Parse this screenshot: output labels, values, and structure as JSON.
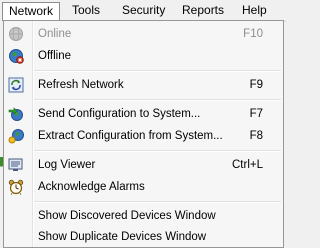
{
  "menubar": {
    "items": [
      "Network",
      "Tools",
      "Security",
      "Reports",
      "Help"
    ]
  },
  "menu": {
    "online": {
      "label": "Online",
      "shortcut": "F10",
      "icon": "online-globe-icon",
      "enabled": false
    },
    "offline": {
      "label": "Offline",
      "icon": "offline-globe-icon"
    },
    "refresh": {
      "label": "Refresh Network",
      "shortcut": "F9",
      "icon": "refresh-icon"
    },
    "send": {
      "label": "Send Configuration to System...",
      "shortcut": "F7",
      "icon": "send-configuration-icon"
    },
    "extract": {
      "label": "Extract Configuration from System...",
      "shortcut": "F8",
      "icon": "extract-configuration-icon"
    },
    "log": {
      "label": "Log Viewer",
      "shortcut": "Ctrl+L",
      "icon": "log-viewer-icon"
    },
    "alarms": {
      "label": "Acknowledge Alarms",
      "icon": "alarm-clock-icon"
    },
    "discovered": {
      "label": "Show Discovered Devices Window"
    },
    "duplicate": {
      "label": "Show Duplicate Devices Window"
    }
  }
}
